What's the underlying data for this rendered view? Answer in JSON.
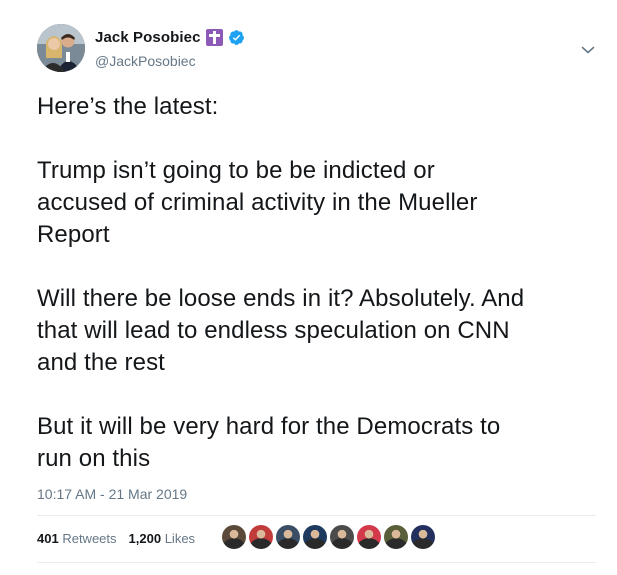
{
  "author": {
    "display_name": "Jack Posobiec",
    "handle": "@JackPosobiec",
    "badge_icon": "latin-cross-icon",
    "verified_icon": "verified-badge-icon",
    "verified_color": "#1da1f2"
  },
  "tweet": {
    "paragraphs": [
      "Here’s the latest:",
      "Trump isn’t going to be be indicted or\naccused of criminal activity in the Mueller\nReport",
      "Will there be loose ends in it? Absolutely. And\nthat will lead to endless speculation on CNN\nand the rest",
      "But it will be very hard for the Democrats to\nrun on this"
    ],
    "timestamp": "10:17 AM - 21 Mar 2019"
  },
  "stats": {
    "retweets_count": "401",
    "retweets_label": "Retweets",
    "likes_count": "1,200",
    "likes_label": "Likes"
  },
  "liker_avatars": [
    {
      "color": "#5b4a3a"
    },
    {
      "color": "#c23b3b"
    },
    {
      "color": "#3a4f66"
    },
    {
      "color": "#1e3a5f"
    },
    {
      "color": "#4b4b4b"
    },
    {
      "color": "#d2394a"
    },
    {
      "color": "#5a5f3a"
    },
    {
      "color": "#23305e"
    }
  ],
  "colors": {
    "text": "#14171a",
    "secondary": "#657786",
    "divider": "#e6ecf0",
    "badge": "#8e5ab7"
  }
}
